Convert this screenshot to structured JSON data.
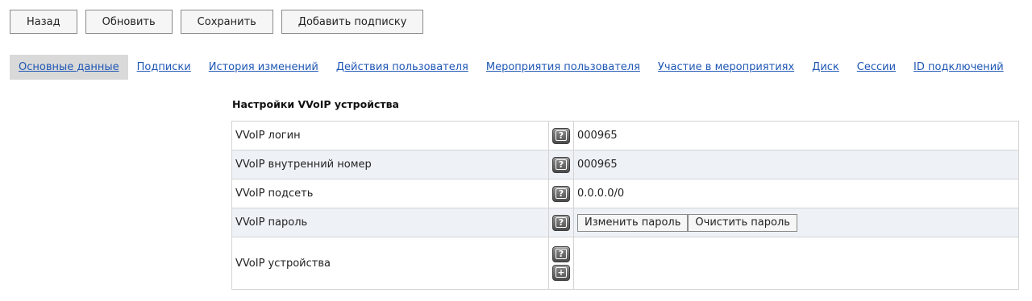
{
  "toolbar": {
    "back": "Назад",
    "refresh": "Обновить",
    "save": "Сохранить",
    "add_subscription": "Добавить подписку"
  },
  "tabs": [
    {
      "label": "Основные данные",
      "active": true
    },
    {
      "label": "Подписки"
    },
    {
      "label": "История изменений"
    },
    {
      "label": "Действия пользователя"
    },
    {
      "label": "Мероприятия пользователя"
    },
    {
      "label": "Участие в мероприятиях"
    },
    {
      "label": "Диск"
    },
    {
      "label": "Сессии"
    },
    {
      "label": "ID подключений"
    }
  ],
  "section": {
    "title": "Настройки VVoIP устройства",
    "rows": [
      {
        "label": "VVoIP логин",
        "value": "000965"
      },
      {
        "label": "VVoIP внутренний номер",
        "value": "000965"
      },
      {
        "label": "VVoIP подсеть",
        "value": "0.0.0.0/0"
      },
      {
        "label": "VVoIP пароль",
        "change_password": "Изменить пароль",
        "clear_password": "Очистить пароль"
      },
      {
        "label": "VVoIP устройства"
      }
    ]
  },
  "icons": {
    "help": "?",
    "add": "+"
  }
}
